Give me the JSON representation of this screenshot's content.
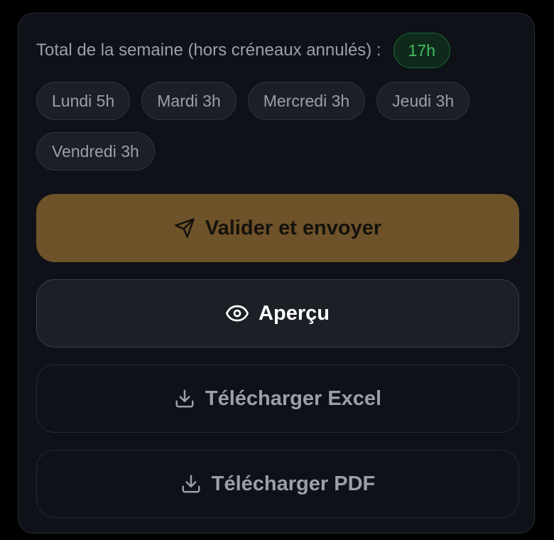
{
  "summary": {
    "total_label": "Total de la semaine (hors créneaux annulés) :",
    "total_value": "17h"
  },
  "days": [
    {
      "label": "Lundi 5h"
    },
    {
      "label": "Mardi 3h"
    },
    {
      "label": "Mercredi 3h"
    },
    {
      "label": "Jeudi 3h"
    },
    {
      "label": "Vendredi 3h"
    }
  ],
  "actions": {
    "submit_label": "Valider et envoyer",
    "preview_label": "Aperçu",
    "excel_label": "Télécharger Excel",
    "pdf_label": "Télécharger PDF"
  },
  "icons": {
    "submit": "send-icon",
    "preview": "eye-icon",
    "excel": "download-icon",
    "pdf": "download-icon"
  },
  "colors": {
    "accent": "#6e5229",
    "success": "#3fbf5f",
    "background": "#0e1117"
  }
}
